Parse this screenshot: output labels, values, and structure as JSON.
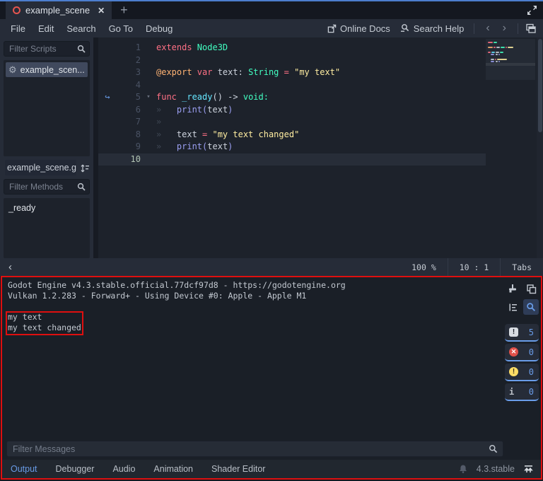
{
  "tab_bar": {
    "tab_label": "example_scene",
    "close_glyph": "✕",
    "plus_glyph": "+"
  },
  "menu": {
    "items": [
      "File",
      "Edit",
      "Search",
      "Go To",
      "Debug"
    ],
    "online_docs": "Online Docs",
    "search_help": "Search Help",
    "back_glyph": "‹",
    "forward_glyph": "›"
  },
  "scripts_panel": {
    "filter_placeholder": "Filter Scripts",
    "item_label": "example_scen...",
    "path": "example_scene.g"
  },
  "methods_panel": {
    "filter_placeholder": "Filter Methods",
    "item_label": "_ready"
  },
  "editor": {
    "status": {
      "zoom": "100 %",
      "line_col": "10 :   1",
      "indent_mode": "Tabs",
      "collapse_glyph": "‹"
    },
    "lines": [
      {
        "n": "1",
        "tokens": [
          [
            "kw",
            "extends "
          ],
          [
            "type",
            "Node3D"
          ]
        ]
      },
      {
        "n": "2",
        "tokens": []
      },
      {
        "n": "3",
        "tokens": [
          [
            "ann",
            "@export "
          ],
          [
            "kw",
            "var "
          ],
          [
            "pl",
            "text: "
          ],
          [
            "type",
            "String "
          ],
          [
            "kw",
            "= "
          ],
          [
            "str",
            "\"my text\""
          ]
        ]
      },
      {
        "n": "4",
        "tokens": []
      },
      {
        "n": "5",
        "fold": true,
        "override": true,
        "tokens": [
          [
            "kw",
            "func "
          ],
          [
            "fndef",
            "_ready"
          ],
          [
            "pl",
            "() -> "
          ],
          [
            "type",
            "void:"
          ]
        ]
      },
      {
        "n": "6",
        "tokens": [
          [
            "ind",
            "»   "
          ],
          [
            "fn",
            "print("
          ],
          [
            "pl",
            "text"
          ],
          [
            "fn",
            ")"
          ]
        ]
      },
      {
        "n": "7",
        "tokens": [
          [
            "ind",
            "»"
          ]
        ]
      },
      {
        "n": "8",
        "tokens": [
          [
            "ind",
            "»   "
          ],
          [
            "pl",
            "text "
          ],
          [
            "kw",
            "= "
          ],
          [
            "str",
            "\"my text changed\""
          ]
        ]
      },
      {
        "n": "9",
        "tokens": [
          [
            "ind",
            "»   "
          ],
          [
            "fn",
            "print("
          ],
          [
            "pl",
            "text"
          ],
          [
            "fn",
            ")"
          ]
        ]
      },
      {
        "n": "10",
        "current": true,
        "tokens": []
      }
    ]
  },
  "output": {
    "log": [
      "Godot Engine v4.3.stable.official.77dcf97d8 - https://godotengine.org",
      "Vulkan 1.2.283 - Forward+ - Using Device #0: Apple - Apple M1",
      ""
    ],
    "messages": [
      "my text",
      "my text changed"
    ],
    "filters": [
      {
        "name": "messages",
        "count": "5"
      },
      {
        "name": "errors",
        "count": "0"
      },
      {
        "name": "warnings",
        "count": "0"
      },
      {
        "name": "editor",
        "count": "0"
      }
    ],
    "filter_placeholder": "Filter Messages"
  },
  "panel_tabs": {
    "tabs": [
      "Output",
      "Debugger",
      "Audio",
      "Animation",
      "Shader Editor"
    ],
    "active_index": 0,
    "version": "4.3.stable"
  },
  "colors": {
    "accent": "#699ce8",
    "annotation_red": "#df0f0f",
    "token_kw": "#ff7085",
    "token_type": "#42ffc2",
    "token_annotation": "#ffb373",
    "token_string": "#ffeda1",
    "token_fncall": "#9b9ff2",
    "token_fndef": "#66e6ff",
    "token_plain": "#cdd3dd"
  }
}
